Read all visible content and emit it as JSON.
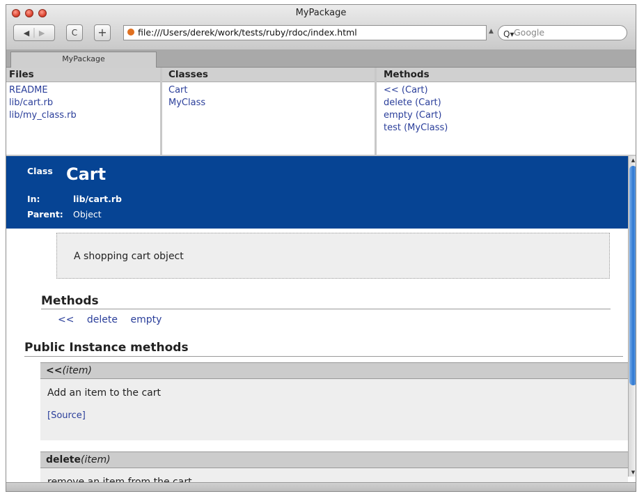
{
  "window": {
    "title": "MyPackage",
    "url": "file:///Users/derek/work/tests/ruby/rdoc/index.html",
    "search_placeholder": "Google",
    "reload_glyph": "C",
    "add_glyph": "+"
  },
  "tab": {
    "label": "MyPackage"
  },
  "files": {
    "heading": "Files",
    "items": [
      "README",
      "lib/cart.rb",
      "lib/my_class.rb"
    ]
  },
  "classes": {
    "heading": "Classes",
    "items": [
      "Cart",
      "MyClass"
    ]
  },
  "methods_index": {
    "heading": "Methods",
    "items": [
      "<< (Cart)",
      "delete (Cart)",
      "empty (Cart)",
      "test (MyClass)"
    ]
  },
  "class_header": {
    "class_label": "Class",
    "class_name": "Cart",
    "in_label": "In:",
    "in_value": "lib/cart.rb",
    "parent_label": "Parent:",
    "parent_value": "Object"
  },
  "description": "A shopping cart object",
  "methods_section": {
    "heading": "Methods",
    "links": [
      "<<",
      "delete",
      "empty"
    ]
  },
  "public_instance": {
    "heading": "Public Instance methods",
    "methods": [
      {
        "name": "<<",
        "args": "(item)",
        "description": "Add an item to the cart",
        "source_label": "[Source]"
      },
      {
        "name": "delete",
        "args": "(item)",
        "description": "remove an item from the cart"
      }
    ]
  },
  "colors": {
    "class_header_bg": "#064494",
    "link": "#2a3e9a",
    "pane_heading_bg": "#d0d0d0"
  },
  "icons": [
    "back-icon",
    "forward-icon",
    "reload-icon",
    "add-bookmark-icon",
    "favicon-icon",
    "search-icon",
    "close-window-icon",
    "minimize-icon",
    "zoom-icon"
  ]
}
